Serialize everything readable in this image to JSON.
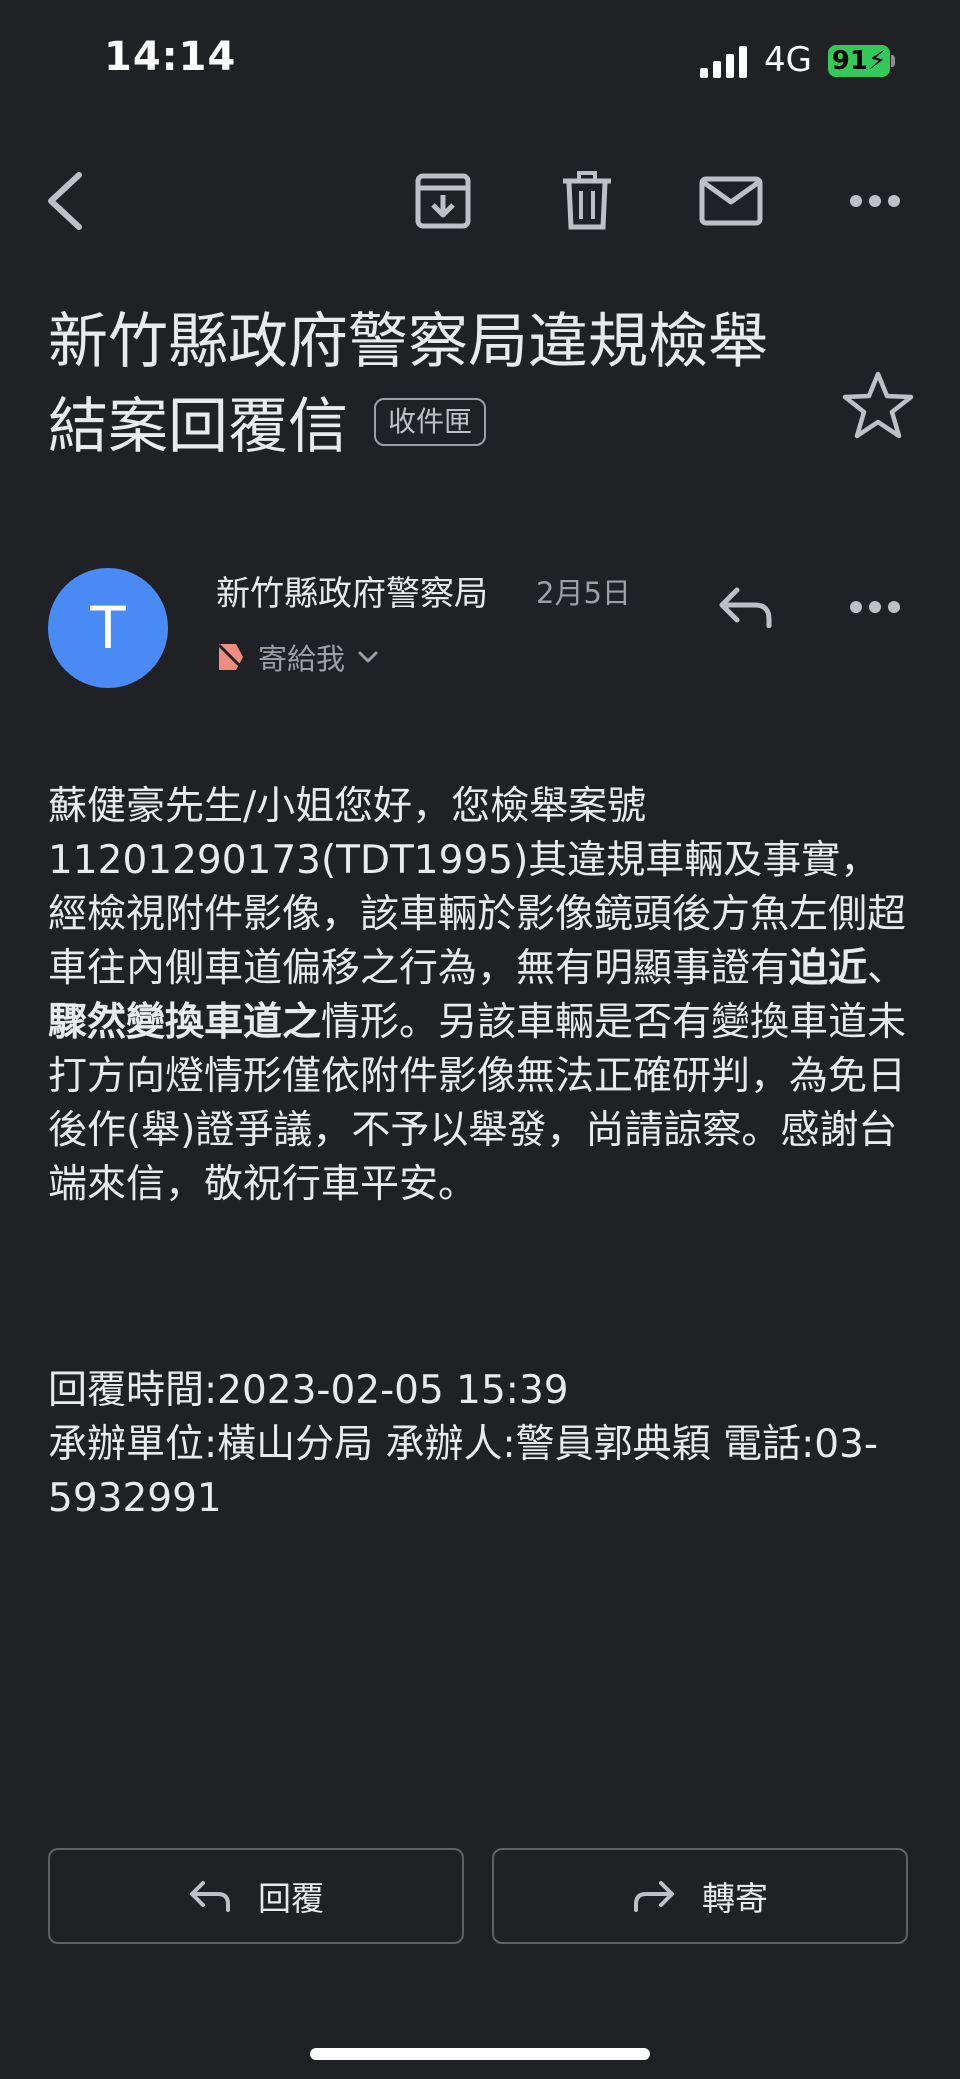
{
  "status": {
    "time": "14:14",
    "network": "4G",
    "battery": "91"
  },
  "toolbar": {
    "back_icon": "chevron-left-icon",
    "archive_icon": "archive-icon",
    "delete_icon": "trash-icon",
    "mark_unread_icon": "mail-icon",
    "more_icon": "more-horizontal-icon"
  },
  "email": {
    "subject_line1": "新竹縣政府警察局違規檢舉",
    "subject_line2": "結案回覆信",
    "label": "收件匣",
    "sender_initial": "T",
    "sender_name": "新竹縣政府警察局",
    "date": "2月5日",
    "to": "寄給我",
    "body_part1": "蘇健豪先生/小姐您好，您檢舉案號11201290173(TDT1995)其違規車輛及事實，經檢視附件影像，該車輛於影像鏡頭後方魚左側超車往內側車道偏移之行為，無有明顯事證有",
    "body_bold1": "迫近",
    "body_sep": "、",
    "body_bold2": "驟然變換車道之",
    "body_part2": "情形。另該車輛是否有變換車道未打方向燈情形僅依附件影像無法正確研判，為免日後作(舉)證爭議，不予以舉發，尚請諒察。感謝台端來信，敬祝行車平安。",
    "reply_time": "回覆時間:2023-02-05 15:39",
    "handler": "承辦單位:橫山分局 承辦人:警員郭典穎 電話:03-5932991"
  },
  "actions": {
    "reply_label": "回覆",
    "forward_label": "轉寄"
  },
  "colors": {
    "background": "#202124",
    "avatar": "#4a8af4",
    "battery": "#34c759",
    "important_tag": "#f28b82"
  }
}
